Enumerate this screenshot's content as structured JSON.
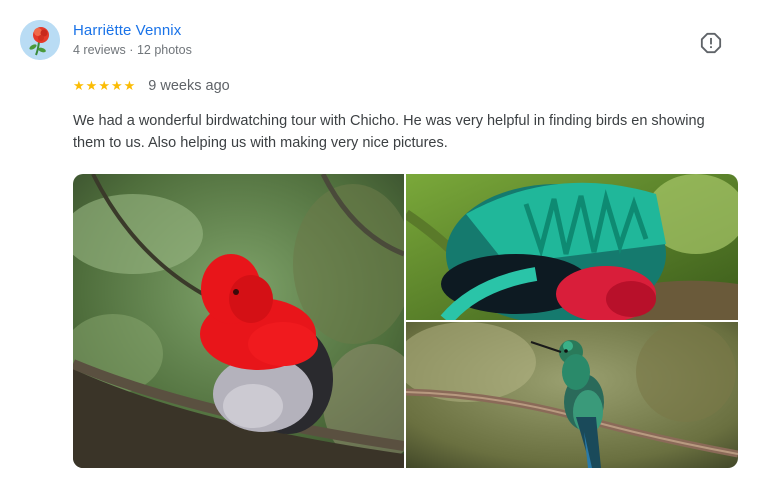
{
  "reviewer": {
    "name": "Harriëtte Vennix",
    "reviews": "4 reviews",
    "separator": "·",
    "photos": "12 photos"
  },
  "review": {
    "rating": 5,
    "time_ago": "9 weeks ago",
    "text": "We had a wonderful birdwatching tour with Chicho. He was very helpful in finding birds en showing them to us. Also helping us with making very nice pictures."
  },
  "icons": {
    "avatar": "rose-icon",
    "report": "report-flag-icon",
    "star": "star-icon"
  },
  "colors": {
    "name_link": "#1a73e8",
    "star": "#fbbc04",
    "meta_text": "#70757a"
  }
}
